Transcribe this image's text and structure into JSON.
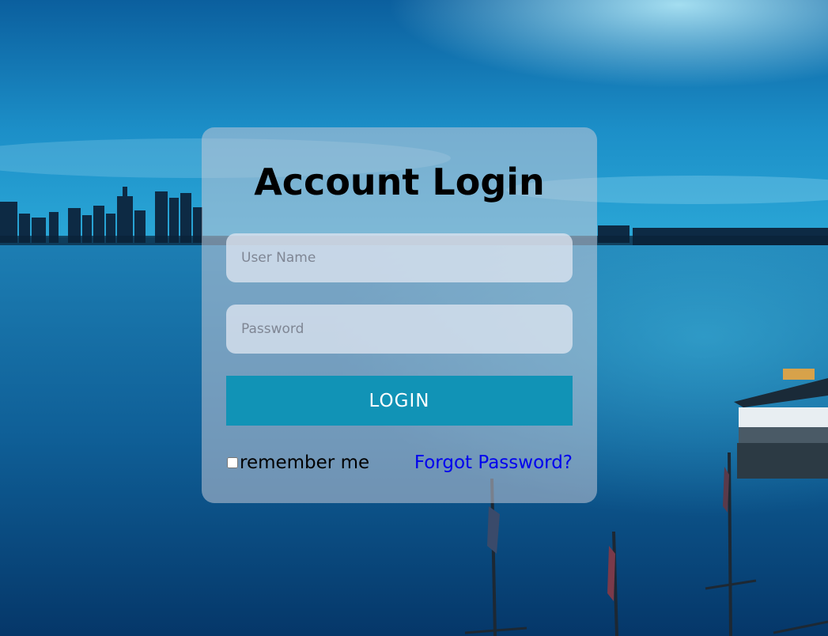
{
  "login": {
    "title": "Account Login",
    "username_placeholder": "User Name",
    "password_placeholder": "Password",
    "login_button": "LOGIN",
    "remember_label": "remember me",
    "forgot_link": "Forgot Password?"
  },
  "colors": {
    "button": "#1193b6",
    "link": "#0000ee"
  }
}
